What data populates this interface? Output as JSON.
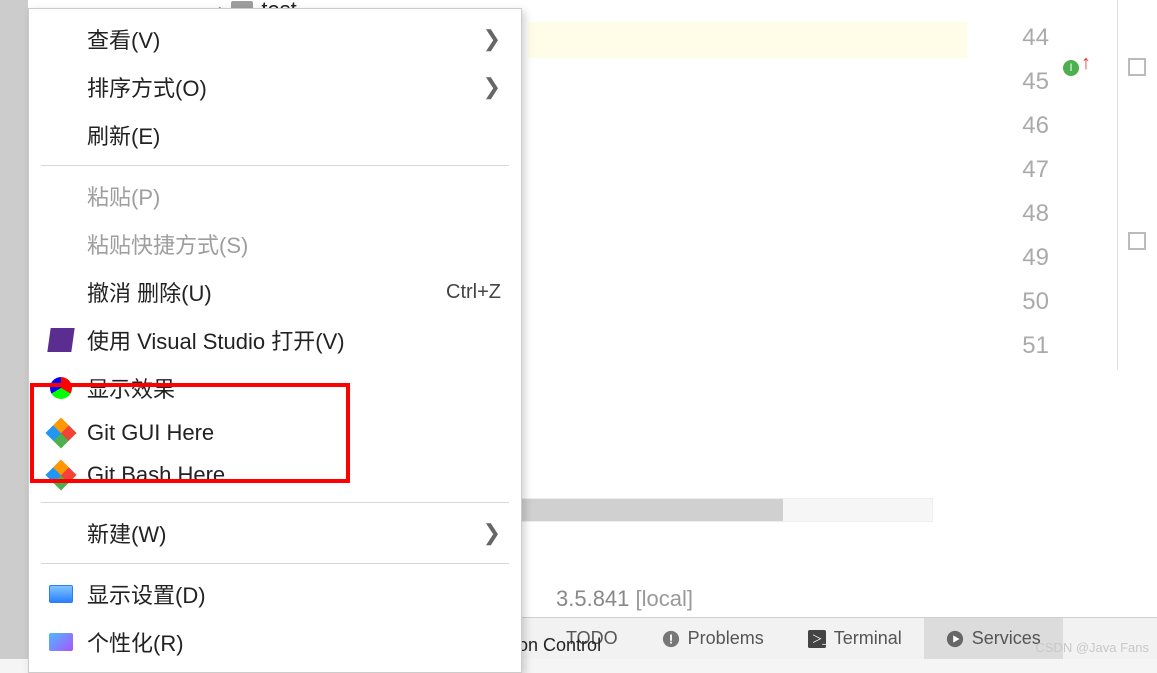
{
  "tree": {
    "folder_label": "test"
  },
  "gutter": {
    "lines": [
      "44",
      "45",
      "46",
      "47",
      "48",
      "49",
      "50",
      "51"
    ],
    "marker": "I"
  },
  "version_line": {
    "version": "3.5.841",
    "scope": "[local]"
  },
  "bottom_tabs": {
    "version_control": "Version Control",
    "todo": "TODO",
    "problems": "Problems",
    "terminal": "Terminal",
    "services": "Services"
  },
  "context_menu": {
    "view": "查看(V)",
    "sort": "排序方式(O)",
    "refresh": "刷新(E)",
    "paste": "粘贴(P)",
    "paste_shortcut": "粘贴快捷方式(S)",
    "undo_delete": "撤消 删除(U)",
    "undo_delete_key": "Ctrl+Z",
    "open_vs": "使用 Visual Studio 打开(V)",
    "display_effect": "显示效果",
    "git_gui": "Git GUI Here",
    "git_bash": "Git Bash Here",
    "new": "新建(W)",
    "display_settings": "显示设置(D)",
    "personalize": "个性化(R)"
  },
  "watermark": "CSDN @Java Fans"
}
